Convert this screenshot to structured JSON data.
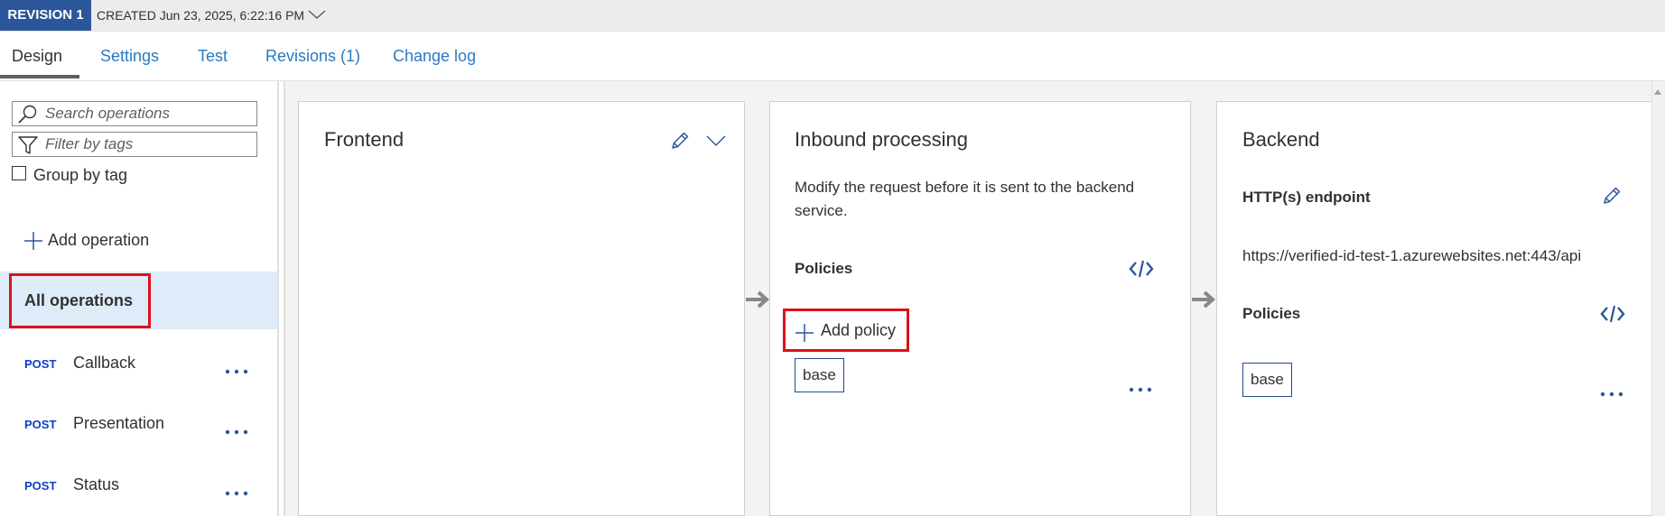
{
  "revision": {
    "badge": "REVISION 1",
    "created": "CREATED Jun 23, 2025, 6:22:16 PM",
    "expand_icon": "chevron-down-icon"
  },
  "tabs": [
    {
      "label": "Design",
      "active": true
    },
    {
      "label": "Settings"
    },
    {
      "label": "Test"
    },
    {
      "label": "Revisions (1)"
    },
    {
      "label": "Change log"
    }
  ],
  "sidebar": {
    "search_placeholder": "Search operations",
    "filter_placeholder": "Filter by tags",
    "group_by_tag": "Group by tag",
    "group_by_tag_checked": false,
    "add_operation": "Add operation",
    "all_operations": "All operations",
    "operations": [
      {
        "verb": "POST",
        "name": "Callback"
      },
      {
        "verb": "POST",
        "name": "Presentation"
      },
      {
        "verb": "POST",
        "name": "Status"
      }
    ]
  },
  "frontend": {
    "title": "Frontend"
  },
  "inbound": {
    "title": "Inbound processing",
    "description": "Modify the request before it is sent to the backend service.",
    "policies_label": "Policies",
    "add_policy": "Add policy",
    "policy_tag": "base"
  },
  "backend": {
    "title": "Backend",
    "endpoint_label": "HTTP(s) endpoint",
    "endpoint_url": "https://verified-id-test-1.azurewebsites.net:443/api",
    "policies_label": "Policies",
    "policy_tag": "base"
  },
  "colors": {
    "accent": "#2b579a",
    "link": "#2b79c2",
    "selected_bg": "#deecf9",
    "highlight": "#e0101a",
    "post_verb": "#0d3fc8"
  }
}
